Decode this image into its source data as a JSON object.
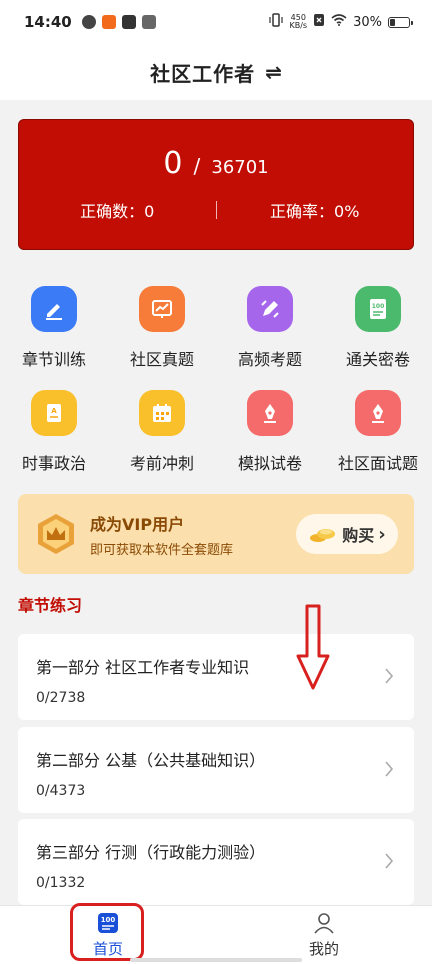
{
  "status_bar": {
    "time": "14:40",
    "speed_value": "450",
    "speed_unit": "KB/s",
    "battery": "30%"
  },
  "header": {
    "title": "社区工作者",
    "switch_icon": "⇌"
  },
  "score": {
    "done": "0",
    "separator": "/",
    "total": "36701",
    "correct_count": "正确数：0",
    "correct_rate": "正确率：0%"
  },
  "grid": [
    {
      "label": "章节训练",
      "icon": "edit-icon",
      "color": "#3c7bf6"
    },
    {
      "label": "社区真题",
      "icon": "chart-icon",
      "color": "#f77c3a"
    },
    {
      "label": "高频考题",
      "icon": "pencil-icon",
      "color": "#a566ec"
    },
    {
      "label": "通关密卷",
      "icon": "score-100-icon",
      "color": "#4cba6c"
    },
    {
      "label": "时事政治",
      "icon": "document-icon",
      "color": "#f9c02c"
    },
    {
      "label": "考前冲刺",
      "icon": "calendar-icon",
      "color": "#f9c02c"
    },
    {
      "label": "模拟试卷",
      "icon": "pen-icon",
      "color": "#f56a6a"
    },
    {
      "label": "社区面试题",
      "icon": "pen-icon",
      "color": "#f56a6a"
    }
  ],
  "vip": {
    "title": "成为VIP用户",
    "subtitle": "即可获取本软件全套题库",
    "buy_label": "购买",
    "buy_chevron": "›"
  },
  "section": {
    "title": "章节练习"
  },
  "chapters": [
    {
      "title": "第一部分  社区工作者专业知识",
      "progress": "0/2738"
    },
    {
      "title": "第二部分  公基（公共基础知识）",
      "progress": "0/4373"
    },
    {
      "title": "第三部分  行测（行政能力测验）",
      "progress": "0/1332"
    }
  ],
  "bottom_nav": {
    "home_icon_text": "100",
    "home_label": "首页",
    "me_label": "我的"
  },
  "colors": {
    "accent_red": "#c10d03",
    "nav_active": "#1a4fd8",
    "vip_bg": "#fbe0ad",
    "vip_text": "#8a4a05"
  }
}
